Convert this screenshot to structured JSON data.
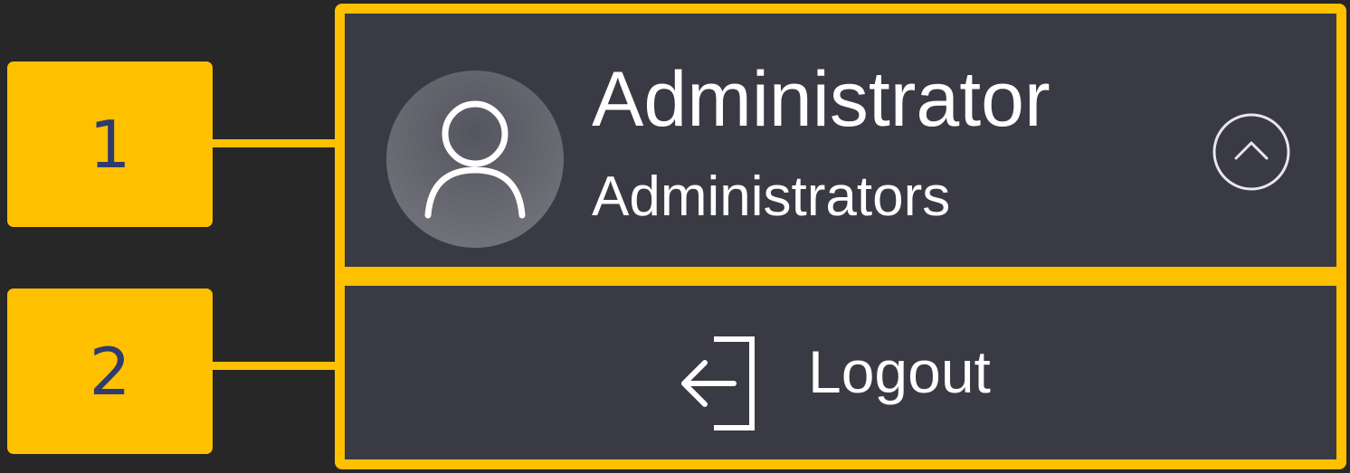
{
  "callouts": [
    {
      "number": "1"
    },
    {
      "number": "2"
    }
  ],
  "user_panel": {
    "avatar_icon": "user-icon",
    "name": "Administrator",
    "role": "Administrators",
    "toggle_icon": "chevron-up-circle-icon"
  },
  "logout": {
    "icon": "logout-icon",
    "label": "Logout"
  },
  "colors": {
    "highlight": "#FFC000",
    "callout_text": "#2F3B6E",
    "panel_background": "#3A3A45",
    "page_background": "#272727",
    "text": "#FFFFFF"
  }
}
